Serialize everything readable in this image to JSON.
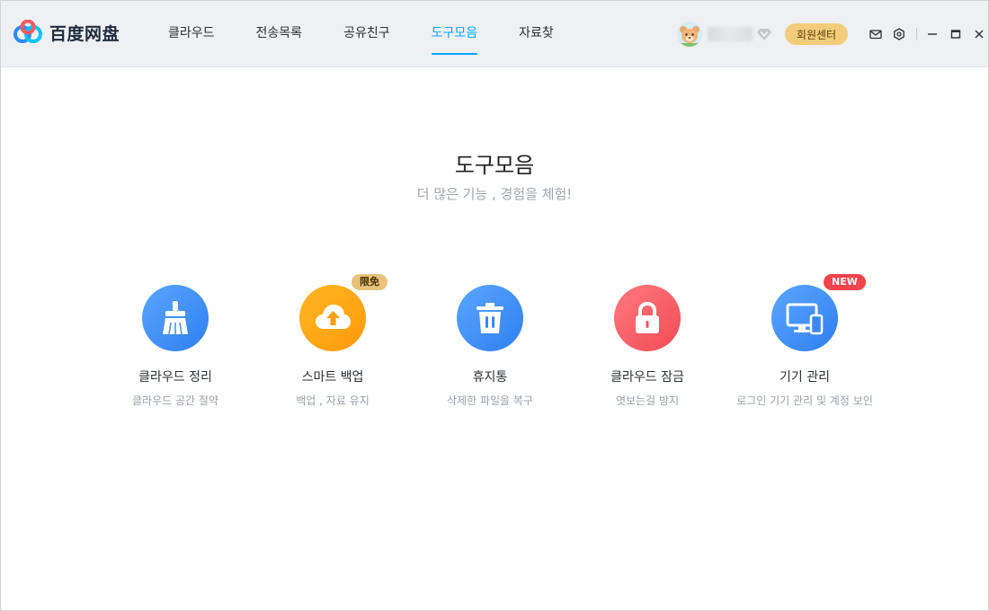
{
  "app": {
    "logo_text": "百度网盘",
    "accent_color": "#06a7ff"
  },
  "nav": {
    "items": [
      {
        "label": "클라우드"
      },
      {
        "label": "전송목록"
      },
      {
        "label": "공유친구"
      },
      {
        "label": "도구모음",
        "active": true
      },
      {
        "label": "자료찾"
      }
    ]
  },
  "header": {
    "username": "",
    "member_button": "회원센터",
    "icons": [
      "mail-icon",
      "settings-icon",
      "minimize-icon",
      "maximize-icon",
      "close-icon"
    ]
  },
  "main": {
    "title": "도구모음",
    "subtitle": "더 많은 기능 , 경험을 체험!",
    "tools": [
      {
        "name": "클라우드 정리",
        "desc": "클라우드 공간 절약",
        "icon": "broom-icon",
        "badge": ""
      },
      {
        "name": "스마트 백업",
        "desc": "백업 , 자료 유지",
        "icon": "cloud-upload-icon",
        "badge": "限免"
      },
      {
        "name": "휴지통",
        "desc": "삭제한 파일을 복구",
        "icon": "trash-icon",
        "badge": ""
      },
      {
        "name": "클라우드 잠금",
        "desc": "엿보는걸 방지",
        "icon": "lock-icon",
        "badge": ""
      },
      {
        "name": "기기 관리",
        "desc": "로그인 기기 관리 및 계정 보인",
        "icon": "devices-icon",
        "badge": "NEW"
      }
    ]
  }
}
